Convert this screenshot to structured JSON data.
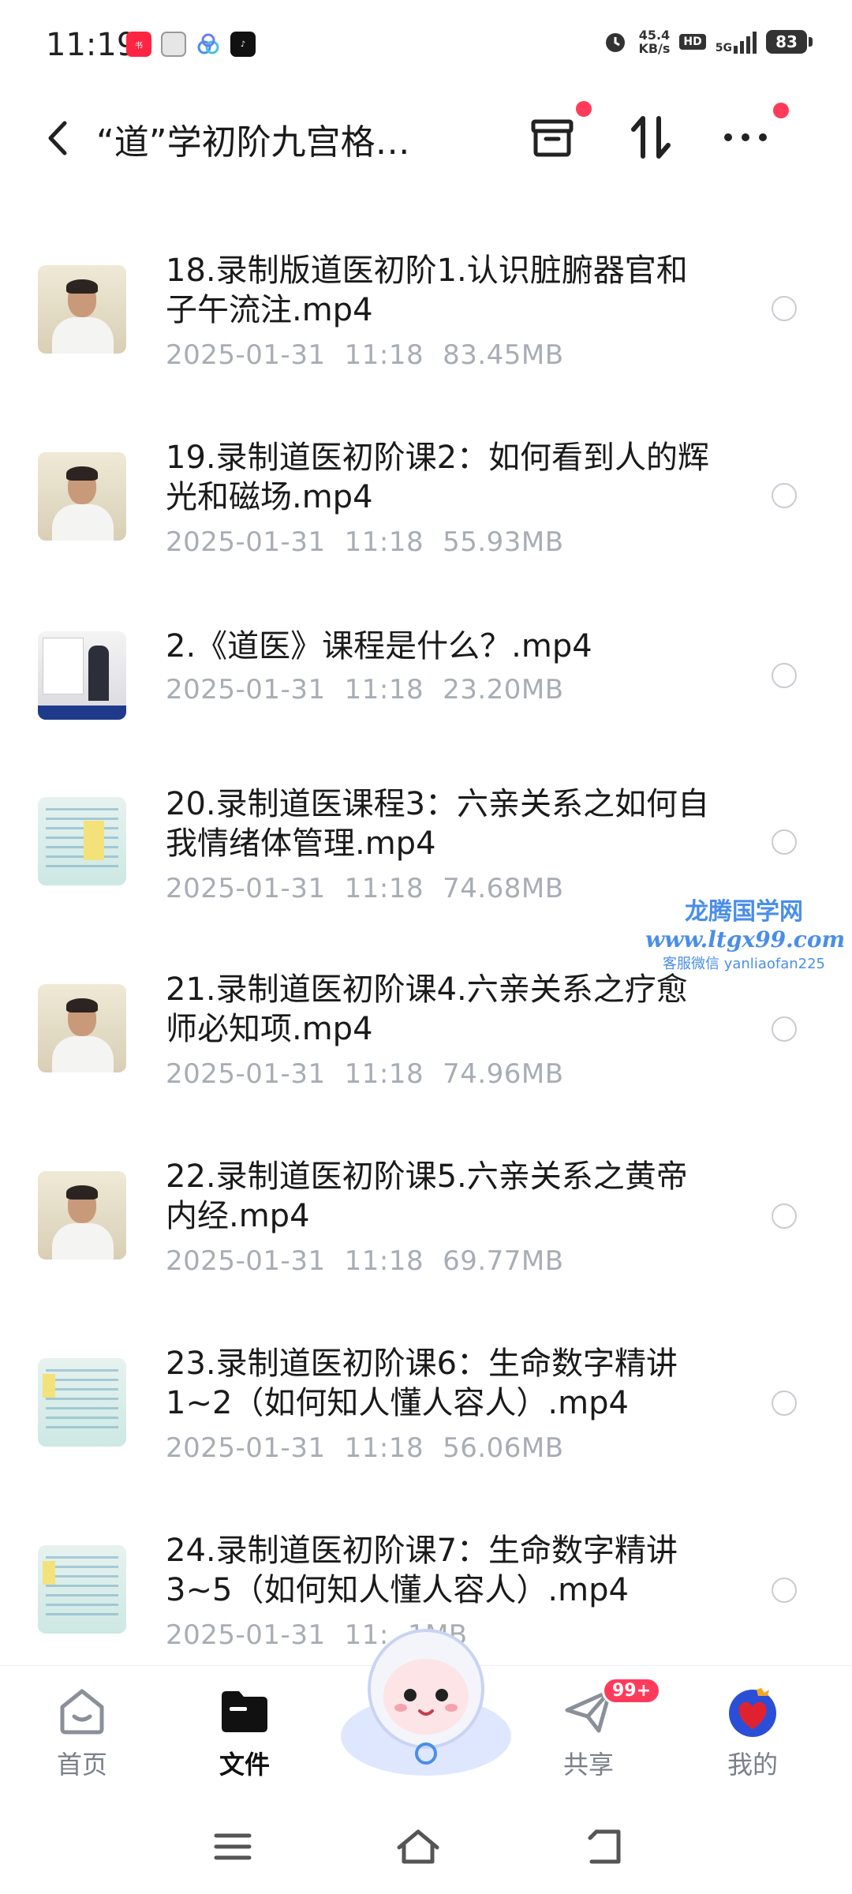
{
  "status_bar": {
    "time": "11:19",
    "net_speed_value": "45.4",
    "net_speed_unit": "KB/s",
    "hd": "HD",
    "network": "5G",
    "battery": "83"
  },
  "header": {
    "title": "“道”学初阶九宫格…",
    "icons": [
      "back-icon",
      "archive-icon",
      "sort-icon",
      "more-icon"
    ]
  },
  "files": [
    {
      "name": "18.录制版道医初阶1.认识脏腑器官和子午流注.mp4",
      "date": "2025-01-31",
      "time": "11:18",
      "size": "83.45MB",
      "thumb": "person"
    },
    {
      "name": "19.录制道医初阶课2：如何看到人的辉光和磁场.mp4",
      "date": "2025-01-31",
      "time": "11:18",
      "size": "55.93MB",
      "thumb": "person"
    },
    {
      "name": "2.《道医》课程是什么？.mp4",
      "date": "2025-01-31",
      "time": "11:18",
      "size": "23.20MB",
      "thumb": "talk"
    },
    {
      "name": "20.录制道医课程3：六亲关系之如何自我情绪体管理.mp4",
      "date": "2025-01-31",
      "time": "11:18",
      "size": "74.68MB",
      "thumb": "slide"
    },
    {
      "name": "21.录制道医初阶课4.六亲关系之疗愈师必知项.mp4",
      "date": "2025-01-31",
      "time": "11:18",
      "size": "74.96MB",
      "thumb": "person"
    },
    {
      "name": "22.录制道医初阶课5.六亲关系之黄帝内经.mp4",
      "date": "2025-01-31",
      "time": "11:18",
      "size": "69.77MB",
      "thumb": "person"
    },
    {
      "name": "23.录制道医初阶课6：生命数字精讲1~2（如何知人懂人容人）.mp4",
      "date": "2025-01-31",
      "time": "11:18",
      "size": "56.06MB",
      "thumb": "slide"
    },
    {
      "name": "24.录制道医初阶课7：生命数字精讲3~5（如何知人懂人容人）.mp4",
      "date": "2025-01-31",
      "time": "11:",
      "size": "1MB",
      "thumb": "slide"
    }
  ],
  "watermark": {
    "line1": "龙腾国学网",
    "line2": "www.ltgx99.com",
    "line3": "客服微信 yanliaofan225"
  },
  "tabs": [
    {
      "label": "首页",
      "icon": "home-icon",
      "active": false
    },
    {
      "label": "文件",
      "icon": "folder-icon",
      "active": true
    },
    {
      "label": "共享",
      "icon": "share-icon",
      "active": false,
      "badge": "99+"
    },
    {
      "label": "我的",
      "icon": "profile-icon",
      "active": false
    }
  ],
  "colors": {
    "accent_red": "#ff3b5c",
    "meta_gray": "#a8adb5",
    "watermark_blue": "#4a8ee8"
  }
}
